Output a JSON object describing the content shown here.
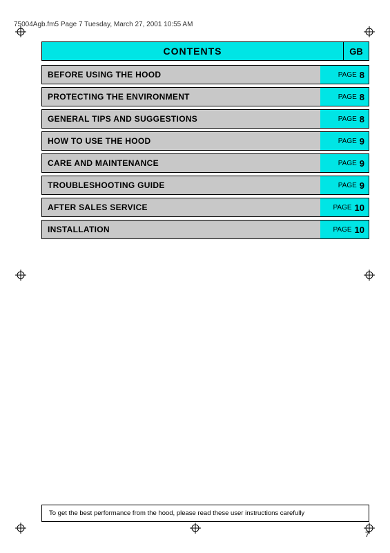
{
  "header": {
    "file_info": "75004Agb.fm5  Page 7  Tuesday, March 27, 2001  10:55 AM"
  },
  "contents": {
    "title": "CONTENTS",
    "gb_label": "GB"
  },
  "toc_rows": [
    {
      "label": "BEFORE USING THE HOOD",
      "page_word": "PAGE",
      "page_num": "8"
    },
    {
      "label": "PROTECTING THE ENVIRONMENT",
      "page_word": "PAGE",
      "page_num": "8"
    },
    {
      "label": "GENERAL TIPS AND SUGGESTIONS",
      "page_word": "PAGE",
      "page_num": "8"
    },
    {
      "label": "HOW TO USE THE HOOD",
      "page_word": "PAGE",
      "page_num": "9"
    },
    {
      "label": "CARE AND MAINTENANCE",
      "page_word": "PAGE",
      "page_num": "9"
    },
    {
      "label": "TROUBLESHOOTING GUIDE",
      "page_word": "PAGE",
      "page_num": "9"
    },
    {
      "label": "AFTER SALES SERVICE",
      "page_word": "PAGE",
      "page_num": "10"
    },
    {
      "label": "INSTALLATION",
      "page_word": "PAGE",
      "page_num": "10"
    }
  ],
  "bottom_note": "To get the best performance from the hood, please read these user instructions carefully",
  "page_number": "7"
}
